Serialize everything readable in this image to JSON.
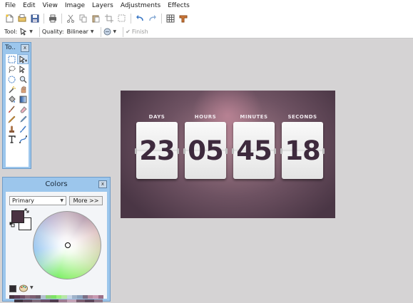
{
  "menubar": {
    "items": [
      "File",
      "Edit",
      "View",
      "Image",
      "Layers",
      "Adjustments",
      "Effects"
    ]
  },
  "toolbar1": {
    "icons": [
      "new-image-icon",
      "open-icon",
      "save-icon",
      "print-icon",
      "cut-icon",
      "copy-icon",
      "paste-icon",
      "crop-icon",
      "deselect-icon",
      "undo-icon",
      "redo-icon",
      "grid-icon",
      "ruler-icon"
    ]
  },
  "toolbar2": {
    "tool_label": "Tool:",
    "quality_label": "Quality:",
    "quality_value": "Bilinear",
    "finish_label": "Finish"
  },
  "tools_panel": {
    "title": "To..",
    "close": "x",
    "tools": [
      "rectangle-select-icon",
      "move-selected-pixels-icon",
      "lasso-select-icon",
      "move-selection-icon",
      "ellipse-select-icon",
      "zoom-icon",
      "magic-wand-icon",
      "pan-icon",
      "paint-bucket-icon",
      "gradient-icon",
      "paintbrush-icon",
      "eraser-icon",
      "pencil-icon",
      "color-picker-icon",
      "clone-stamp-icon",
      "recolor-icon",
      "text-icon",
      "line-curve-icon"
    ]
  },
  "colors_panel": {
    "title": "Colors",
    "close": "x",
    "mode_select": "Primary",
    "more_button": "More >>",
    "primary_color": "#4a3442",
    "secondary_color": "#ffffff",
    "palette": [
      "#4a3442",
      "#5a3a52",
      "#6f4d64",
      "#8a6c7e",
      "#7d5f72",
      "#6b5a68",
      "#b4c0cf",
      "#8fd17a",
      "#7ee266",
      "#9cf07e",
      "#b7e6a8",
      "#c6d4e6",
      "#9fb2c9",
      "#8aa0bb",
      "#7a6f86",
      "#b48aa0",
      "#c79ab2",
      "#9c6f88"
    ],
    "palette2": [
      "#3f3440",
      "#5e4a5c",
      "#7d6a7a",
      "#6c5168",
      "#4f3c4e",
      "#9e7c92",
      "#c2a2b6",
      "#7a5d70",
      "#5c465a",
      "#8e768a"
    ]
  },
  "countdown": {
    "labels": [
      "DAYS",
      "HOURS",
      "MINUTES",
      "SECONDS"
    ],
    "values": [
      "23",
      "05",
      "45",
      "18"
    ]
  }
}
